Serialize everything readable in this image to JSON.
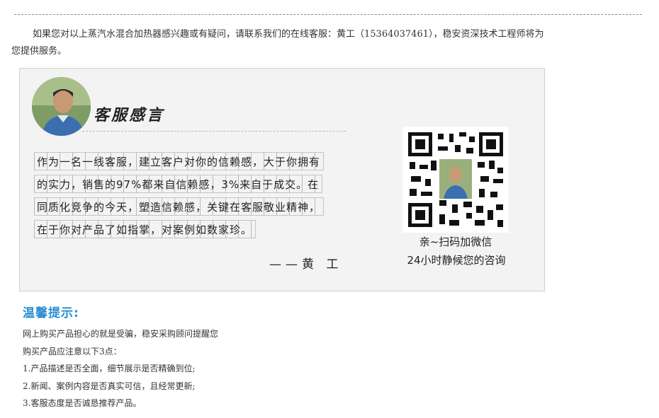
{
  "intro": "如果您对以上蒸汽水混合加热器感兴趣或有疑问，请联系我们的在线客服：黄工（15364037461），稳安资深技术工程师将为您提供服务。",
  "card": {
    "title": "客服感言",
    "lines": [
      "作为一名一线客服，建立客户对你的信赖感，大于你拥有",
      "的实力，销售的97%都来自信赖感，3%来自于成交。在",
      "同质化竞争的今天，塑造信赖感，关键在客服敬业精神，",
      "在于你对产品了如指掌，对案例如数家珍。"
    ],
    "signature": "——黄 工",
    "qr_caption_1": "亲~扫码加微信",
    "qr_caption_2": "24小时静候您的咨询"
  },
  "tips": {
    "title": "温馨提示:",
    "items": [
      "网上购买产品担心的就是受骗，稳安采购顾问提醒您",
      "购买产品应注意以下3点：",
      "1.产品描述是否全面，细节展示是否精确到位;",
      "2.新闻、案例内容是否真实可信，且经常更新;",
      "3.客服态度是否诚恳推荐产品。"
    ]
  },
  "colors": {
    "accent": "#2a8ed3",
    "card_bg": "#f3f3f3"
  }
}
